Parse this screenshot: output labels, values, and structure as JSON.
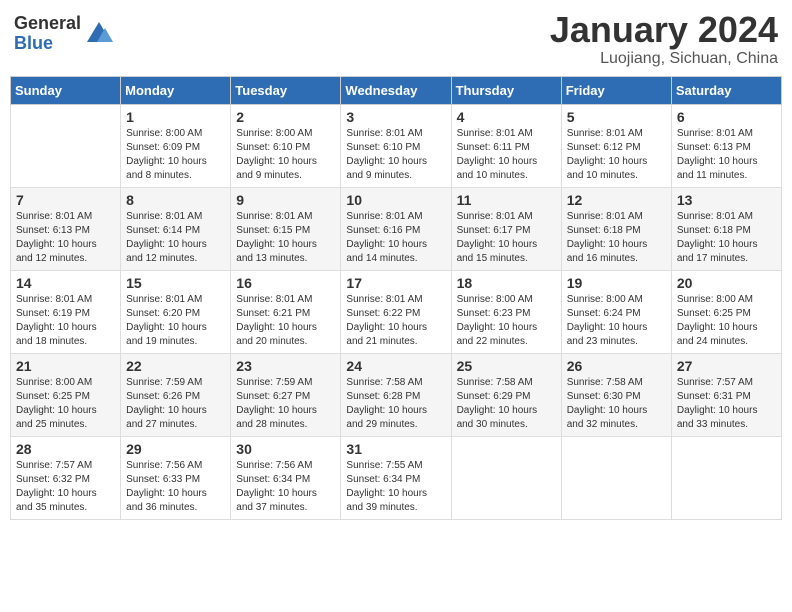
{
  "logo": {
    "general": "General",
    "blue": "Blue"
  },
  "title": "January 2024",
  "location": "Luojiang, Sichuan, China",
  "days_of_week": [
    "Sunday",
    "Monday",
    "Tuesday",
    "Wednesday",
    "Thursday",
    "Friday",
    "Saturday"
  ],
  "weeks": [
    [
      {
        "day": "",
        "sunrise": "",
        "sunset": "",
        "daylight": ""
      },
      {
        "day": "1",
        "sunrise": "Sunrise: 8:00 AM",
        "sunset": "Sunset: 6:09 PM",
        "daylight": "Daylight: 10 hours and 8 minutes."
      },
      {
        "day": "2",
        "sunrise": "Sunrise: 8:00 AM",
        "sunset": "Sunset: 6:10 PM",
        "daylight": "Daylight: 10 hours and 9 minutes."
      },
      {
        "day": "3",
        "sunrise": "Sunrise: 8:01 AM",
        "sunset": "Sunset: 6:10 PM",
        "daylight": "Daylight: 10 hours and 9 minutes."
      },
      {
        "day": "4",
        "sunrise": "Sunrise: 8:01 AM",
        "sunset": "Sunset: 6:11 PM",
        "daylight": "Daylight: 10 hours and 10 minutes."
      },
      {
        "day": "5",
        "sunrise": "Sunrise: 8:01 AM",
        "sunset": "Sunset: 6:12 PM",
        "daylight": "Daylight: 10 hours and 10 minutes."
      },
      {
        "day": "6",
        "sunrise": "Sunrise: 8:01 AM",
        "sunset": "Sunset: 6:13 PM",
        "daylight": "Daylight: 10 hours and 11 minutes."
      }
    ],
    [
      {
        "day": "7",
        "sunrise": "Sunrise: 8:01 AM",
        "sunset": "Sunset: 6:13 PM",
        "daylight": "Daylight: 10 hours and 12 minutes."
      },
      {
        "day": "8",
        "sunrise": "Sunrise: 8:01 AM",
        "sunset": "Sunset: 6:14 PM",
        "daylight": "Daylight: 10 hours and 12 minutes."
      },
      {
        "day": "9",
        "sunrise": "Sunrise: 8:01 AM",
        "sunset": "Sunset: 6:15 PM",
        "daylight": "Daylight: 10 hours and 13 minutes."
      },
      {
        "day": "10",
        "sunrise": "Sunrise: 8:01 AM",
        "sunset": "Sunset: 6:16 PM",
        "daylight": "Daylight: 10 hours and 14 minutes."
      },
      {
        "day": "11",
        "sunrise": "Sunrise: 8:01 AM",
        "sunset": "Sunset: 6:17 PM",
        "daylight": "Daylight: 10 hours and 15 minutes."
      },
      {
        "day": "12",
        "sunrise": "Sunrise: 8:01 AM",
        "sunset": "Sunset: 6:18 PM",
        "daylight": "Daylight: 10 hours and 16 minutes."
      },
      {
        "day": "13",
        "sunrise": "Sunrise: 8:01 AM",
        "sunset": "Sunset: 6:18 PM",
        "daylight": "Daylight: 10 hours and 17 minutes."
      }
    ],
    [
      {
        "day": "14",
        "sunrise": "Sunrise: 8:01 AM",
        "sunset": "Sunset: 6:19 PM",
        "daylight": "Daylight: 10 hours and 18 minutes."
      },
      {
        "day": "15",
        "sunrise": "Sunrise: 8:01 AM",
        "sunset": "Sunset: 6:20 PM",
        "daylight": "Daylight: 10 hours and 19 minutes."
      },
      {
        "day": "16",
        "sunrise": "Sunrise: 8:01 AM",
        "sunset": "Sunset: 6:21 PM",
        "daylight": "Daylight: 10 hours and 20 minutes."
      },
      {
        "day": "17",
        "sunrise": "Sunrise: 8:01 AM",
        "sunset": "Sunset: 6:22 PM",
        "daylight": "Daylight: 10 hours and 21 minutes."
      },
      {
        "day": "18",
        "sunrise": "Sunrise: 8:00 AM",
        "sunset": "Sunset: 6:23 PM",
        "daylight": "Daylight: 10 hours and 22 minutes."
      },
      {
        "day": "19",
        "sunrise": "Sunrise: 8:00 AM",
        "sunset": "Sunset: 6:24 PM",
        "daylight": "Daylight: 10 hours and 23 minutes."
      },
      {
        "day": "20",
        "sunrise": "Sunrise: 8:00 AM",
        "sunset": "Sunset: 6:25 PM",
        "daylight": "Daylight: 10 hours and 24 minutes."
      }
    ],
    [
      {
        "day": "21",
        "sunrise": "Sunrise: 8:00 AM",
        "sunset": "Sunset: 6:25 PM",
        "daylight": "Daylight: 10 hours and 25 minutes."
      },
      {
        "day": "22",
        "sunrise": "Sunrise: 7:59 AM",
        "sunset": "Sunset: 6:26 PM",
        "daylight": "Daylight: 10 hours and 27 minutes."
      },
      {
        "day": "23",
        "sunrise": "Sunrise: 7:59 AM",
        "sunset": "Sunset: 6:27 PM",
        "daylight": "Daylight: 10 hours and 28 minutes."
      },
      {
        "day": "24",
        "sunrise": "Sunrise: 7:58 AM",
        "sunset": "Sunset: 6:28 PM",
        "daylight": "Daylight: 10 hours and 29 minutes."
      },
      {
        "day": "25",
        "sunrise": "Sunrise: 7:58 AM",
        "sunset": "Sunset: 6:29 PM",
        "daylight": "Daylight: 10 hours and 30 minutes."
      },
      {
        "day": "26",
        "sunrise": "Sunrise: 7:58 AM",
        "sunset": "Sunset: 6:30 PM",
        "daylight": "Daylight: 10 hours and 32 minutes."
      },
      {
        "day": "27",
        "sunrise": "Sunrise: 7:57 AM",
        "sunset": "Sunset: 6:31 PM",
        "daylight": "Daylight: 10 hours and 33 minutes."
      }
    ],
    [
      {
        "day": "28",
        "sunrise": "Sunrise: 7:57 AM",
        "sunset": "Sunset: 6:32 PM",
        "daylight": "Daylight: 10 hours and 35 minutes."
      },
      {
        "day": "29",
        "sunrise": "Sunrise: 7:56 AM",
        "sunset": "Sunset: 6:33 PM",
        "daylight": "Daylight: 10 hours and 36 minutes."
      },
      {
        "day": "30",
        "sunrise": "Sunrise: 7:56 AM",
        "sunset": "Sunset: 6:34 PM",
        "daylight": "Daylight: 10 hours and 37 minutes."
      },
      {
        "day": "31",
        "sunrise": "Sunrise: 7:55 AM",
        "sunset": "Sunset: 6:34 PM",
        "daylight": "Daylight: 10 hours and 39 minutes."
      },
      {
        "day": "",
        "sunrise": "",
        "sunset": "",
        "daylight": ""
      },
      {
        "day": "",
        "sunrise": "",
        "sunset": "",
        "daylight": ""
      },
      {
        "day": "",
        "sunrise": "",
        "sunset": "",
        "daylight": ""
      }
    ]
  ]
}
